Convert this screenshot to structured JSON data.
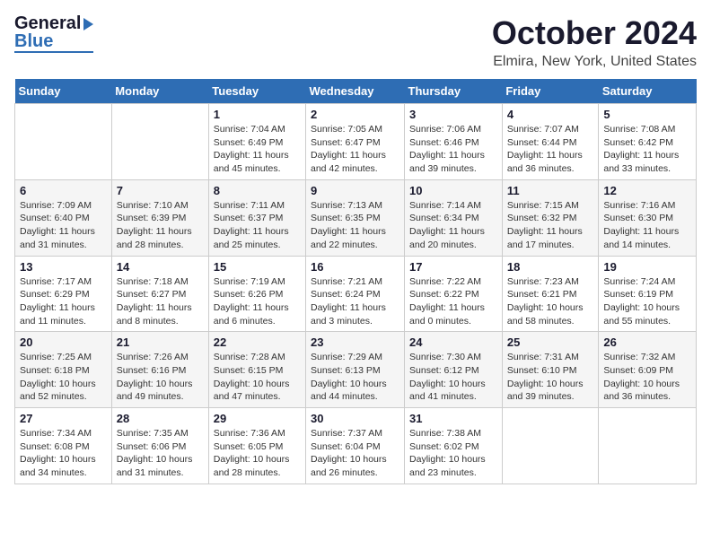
{
  "header": {
    "logo_line1": "General",
    "logo_line2": "Blue",
    "title": "October 2024",
    "subtitle": "Elmira, New York, United States"
  },
  "weekdays": [
    "Sunday",
    "Monday",
    "Tuesday",
    "Wednesday",
    "Thursday",
    "Friday",
    "Saturday"
  ],
  "weeks": [
    [
      {
        "day": "",
        "detail": ""
      },
      {
        "day": "",
        "detail": ""
      },
      {
        "day": "1",
        "detail": "Sunrise: 7:04 AM\nSunset: 6:49 PM\nDaylight: 11 hours and 45 minutes."
      },
      {
        "day": "2",
        "detail": "Sunrise: 7:05 AM\nSunset: 6:47 PM\nDaylight: 11 hours and 42 minutes."
      },
      {
        "day": "3",
        "detail": "Sunrise: 7:06 AM\nSunset: 6:46 PM\nDaylight: 11 hours and 39 minutes."
      },
      {
        "day": "4",
        "detail": "Sunrise: 7:07 AM\nSunset: 6:44 PM\nDaylight: 11 hours and 36 minutes."
      },
      {
        "day": "5",
        "detail": "Sunrise: 7:08 AM\nSunset: 6:42 PM\nDaylight: 11 hours and 33 minutes."
      }
    ],
    [
      {
        "day": "6",
        "detail": "Sunrise: 7:09 AM\nSunset: 6:40 PM\nDaylight: 11 hours and 31 minutes."
      },
      {
        "day": "7",
        "detail": "Sunrise: 7:10 AM\nSunset: 6:39 PM\nDaylight: 11 hours and 28 minutes."
      },
      {
        "day": "8",
        "detail": "Sunrise: 7:11 AM\nSunset: 6:37 PM\nDaylight: 11 hours and 25 minutes."
      },
      {
        "day": "9",
        "detail": "Sunrise: 7:13 AM\nSunset: 6:35 PM\nDaylight: 11 hours and 22 minutes."
      },
      {
        "day": "10",
        "detail": "Sunrise: 7:14 AM\nSunset: 6:34 PM\nDaylight: 11 hours and 20 minutes."
      },
      {
        "day": "11",
        "detail": "Sunrise: 7:15 AM\nSunset: 6:32 PM\nDaylight: 11 hours and 17 minutes."
      },
      {
        "day": "12",
        "detail": "Sunrise: 7:16 AM\nSunset: 6:30 PM\nDaylight: 11 hours and 14 minutes."
      }
    ],
    [
      {
        "day": "13",
        "detail": "Sunrise: 7:17 AM\nSunset: 6:29 PM\nDaylight: 11 hours and 11 minutes."
      },
      {
        "day": "14",
        "detail": "Sunrise: 7:18 AM\nSunset: 6:27 PM\nDaylight: 11 hours and 8 minutes."
      },
      {
        "day": "15",
        "detail": "Sunrise: 7:19 AM\nSunset: 6:26 PM\nDaylight: 11 hours and 6 minutes."
      },
      {
        "day": "16",
        "detail": "Sunrise: 7:21 AM\nSunset: 6:24 PM\nDaylight: 11 hours and 3 minutes."
      },
      {
        "day": "17",
        "detail": "Sunrise: 7:22 AM\nSunset: 6:22 PM\nDaylight: 11 hours and 0 minutes."
      },
      {
        "day": "18",
        "detail": "Sunrise: 7:23 AM\nSunset: 6:21 PM\nDaylight: 10 hours and 58 minutes."
      },
      {
        "day": "19",
        "detail": "Sunrise: 7:24 AM\nSunset: 6:19 PM\nDaylight: 10 hours and 55 minutes."
      }
    ],
    [
      {
        "day": "20",
        "detail": "Sunrise: 7:25 AM\nSunset: 6:18 PM\nDaylight: 10 hours and 52 minutes."
      },
      {
        "day": "21",
        "detail": "Sunrise: 7:26 AM\nSunset: 6:16 PM\nDaylight: 10 hours and 49 minutes."
      },
      {
        "day": "22",
        "detail": "Sunrise: 7:28 AM\nSunset: 6:15 PM\nDaylight: 10 hours and 47 minutes."
      },
      {
        "day": "23",
        "detail": "Sunrise: 7:29 AM\nSunset: 6:13 PM\nDaylight: 10 hours and 44 minutes."
      },
      {
        "day": "24",
        "detail": "Sunrise: 7:30 AM\nSunset: 6:12 PM\nDaylight: 10 hours and 41 minutes."
      },
      {
        "day": "25",
        "detail": "Sunrise: 7:31 AM\nSunset: 6:10 PM\nDaylight: 10 hours and 39 minutes."
      },
      {
        "day": "26",
        "detail": "Sunrise: 7:32 AM\nSunset: 6:09 PM\nDaylight: 10 hours and 36 minutes."
      }
    ],
    [
      {
        "day": "27",
        "detail": "Sunrise: 7:34 AM\nSunset: 6:08 PM\nDaylight: 10 hours and 34 minutes."
      },
      {
        "day": "28",
        "detail": "Sunrise: 7:35 AM\nSunset: 6:06 PM\nDaylight: 10 hours and 31 minutes."
      },
      {
        "day": "29",
        "detail": "Sunrise: 7:36 AM\nSunset: 6:05 PM\nDaylight: 10 hours and 28 minutes."
      },
      {
        "day": "30",
        "detail": "Sunrise: 7:37 AM\nSunset: 6:04 PM\nDaylight: 10 hours and 26 minutes."
      },
      {
        "day": "31",
        "detail": "Sunrise: 7:38 AM\nSunset: 6:02 PM\nDaylight: 10 hours and 23 minutes."
      },
      {
        "day": "",
        "detail": ""
      },
      {
        "day": "",
        "detail": ""
      }
    ]
  ]
}
